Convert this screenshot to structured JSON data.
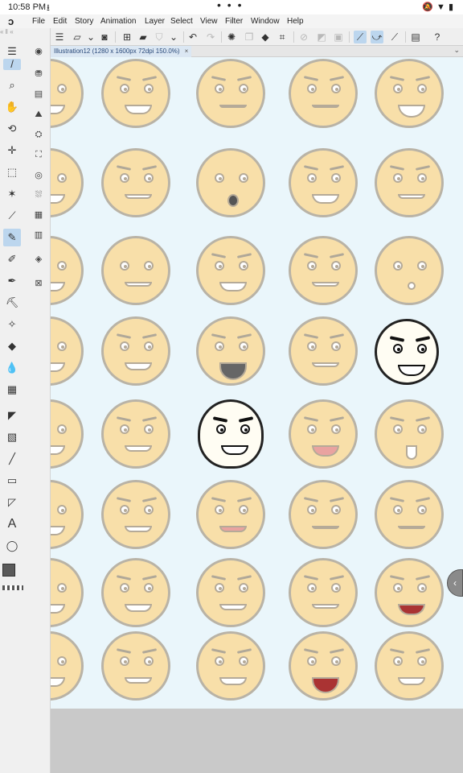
{
  "status_bar": {
    "time": "10:58 PM",
    "download_icon": "download-icon",
    "dots": "• • •",
    "right_icons": "mute-icon wifi-icon battery-icon"
  },
  "menubar": {
    "logo_icon": "clip-studio-logo",
    "items": [
      "File",
      "Edit",
      "Story",
      "Animation",
      "Layer",
      "Select",
      "View",
      "Filter",
      "Window",
      "Help"
    ]
  },
  "toolbar": {
    "buttons": [
      "menu-icon",
      "shape-icon",
      "chevron-down-icon",
      "emblem-icon",
      "new-icon",
      "open-icon",
      "save-icon",
      "chevron-down-icon",
      "undo-icon",
      "redo-icon",
      "spinner-icon",
      "copy-icon",
      "fill-icon",
      "transform-icon",
      "clear-icon",
      "fill-gray-icon",
      "frame-icon",
      "ruler-icon",
      "ruler-curve-icon",
      "ruler-line-icon",
      "panel-icon",
      "help-icon"
    ]
  },
  "document_tab": {
    "title": "Illustration12 (1280 x 1600px 72dpi 150.0%)",
    "close": "×"
  },
  "colors": {
    "canvas_bg": "#eaf6fb",
    "face_fill": "#f8dfa9",
    "main_color": "#5a5a5a",
    "sub_color": "#ffffff",
    "accent": "#bcd6ee"
  }
}
